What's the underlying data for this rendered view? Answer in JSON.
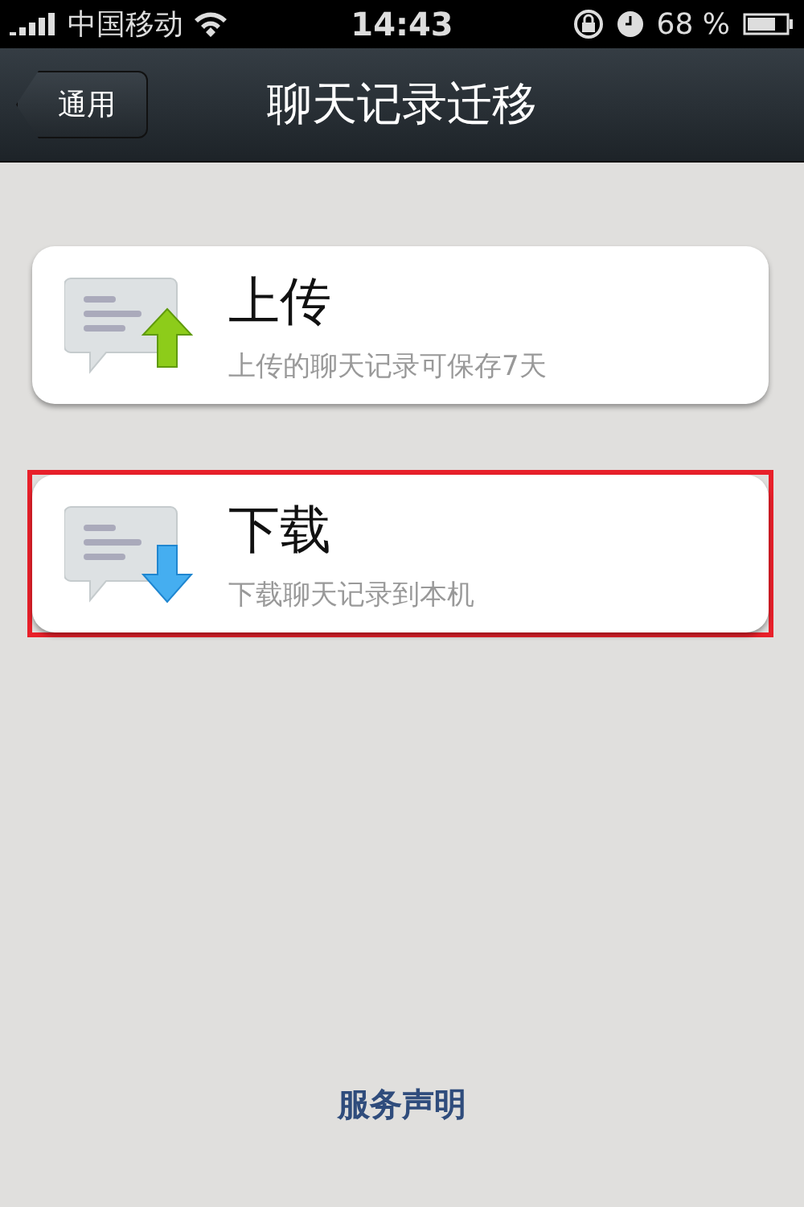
{
  "status_bar": {
    "carrier": "中国移动",
    "time": "14:43",
    "battery": "68 %"
  },
  "nav_bar": {
    "back": "通用",
    "title": "聊天记录迁移"
  },
  "options": [
    {
      "kind": "upload",
      "title": "上传",
      "subtitle": "上传的聊天记录可保存7天",
      "highlighted": false
    },
    {
      "kind": "download",
      "title": "下载",
      "subtitle": "下载聊天记录到本机",
      "highlighted": true
    }
  ],
  "footer_link": "服务声明"
}
